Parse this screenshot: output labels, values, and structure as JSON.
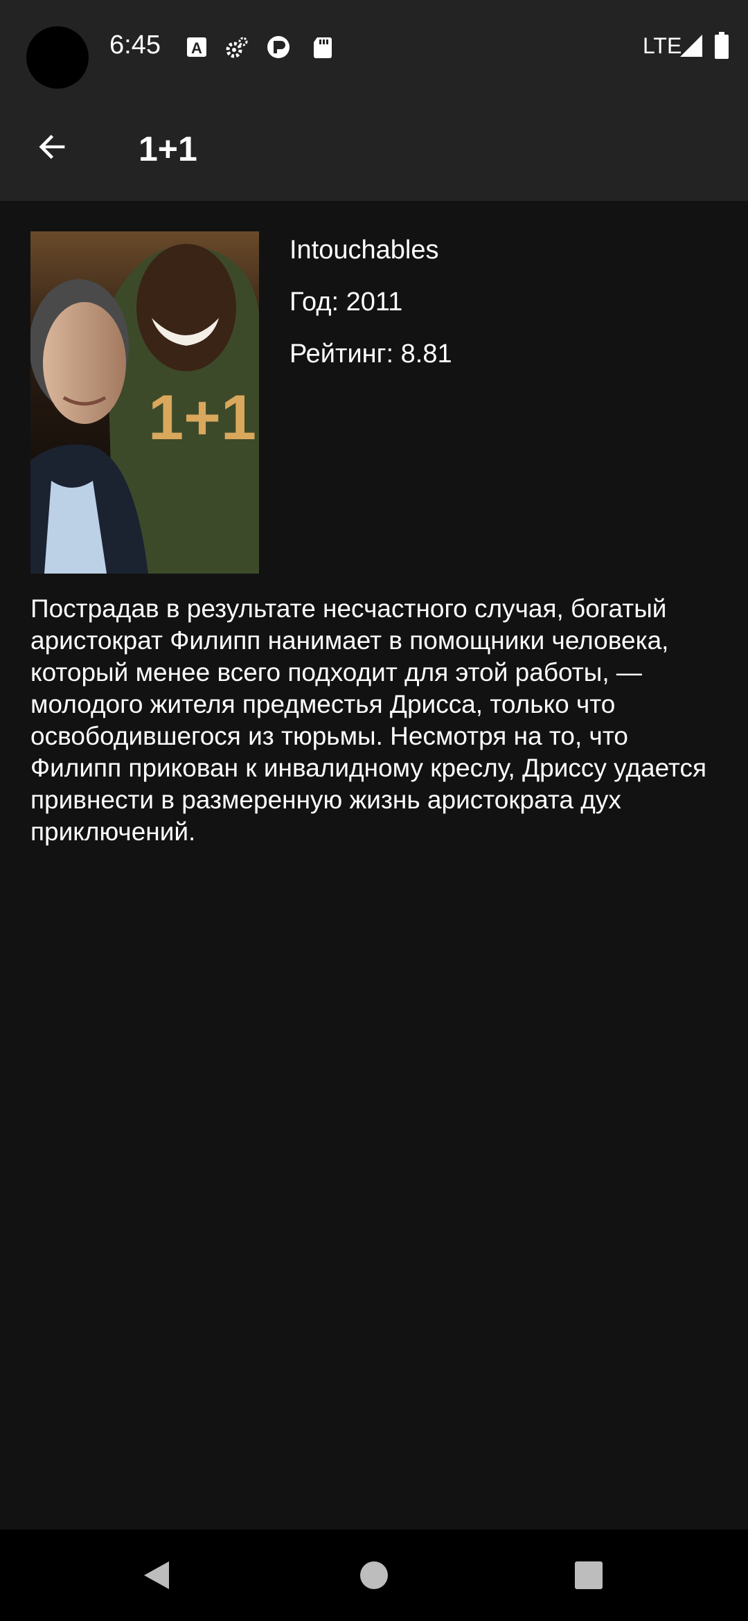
{
  "status_bar": {
    "time": "6:45",
    "network": "LTE",
    "icons": [
      "font-badge-icon",
      "settings-cog-icon",
      "circle-p-icon",
      "sd-card-icon",
      "signal-icon",
      "battery-icon"
    ]
  },
  "app_bar": {
    "title": "1+1",
    "back_icon": "arrow-left-icon"
  },
  "movie": {
    "original_title": "Intouchables",
    "year": "Год: 2011",
    "rating": "Рейтинг: 8.81",
    "poster_text": "1+1",
    "description": "Пострадав в результате несчастного случая, богатый аристократ Филипп нанимает в помощники человека, который менее всего подходит для этой работы, — молодого жителя предместья Дрисса, только что освободившегося из тюрьмы. Несмотря на то, что Филипп прикован к инвалидному креслу, Дриссу удается привнести в размеренную жизнь аристократа дух приключений."
  },
  "nav_bar": {
    "buttons": [
      "back-triangle-icon",
      "home-circle-icon",
      "recents-square-icon"
    ]
  },
  "colors": {
    "background": "#121212",
    "bar": "#232323",
    "nav": "#000000",
    "poster_title": "#d9a85c"
  }
}
